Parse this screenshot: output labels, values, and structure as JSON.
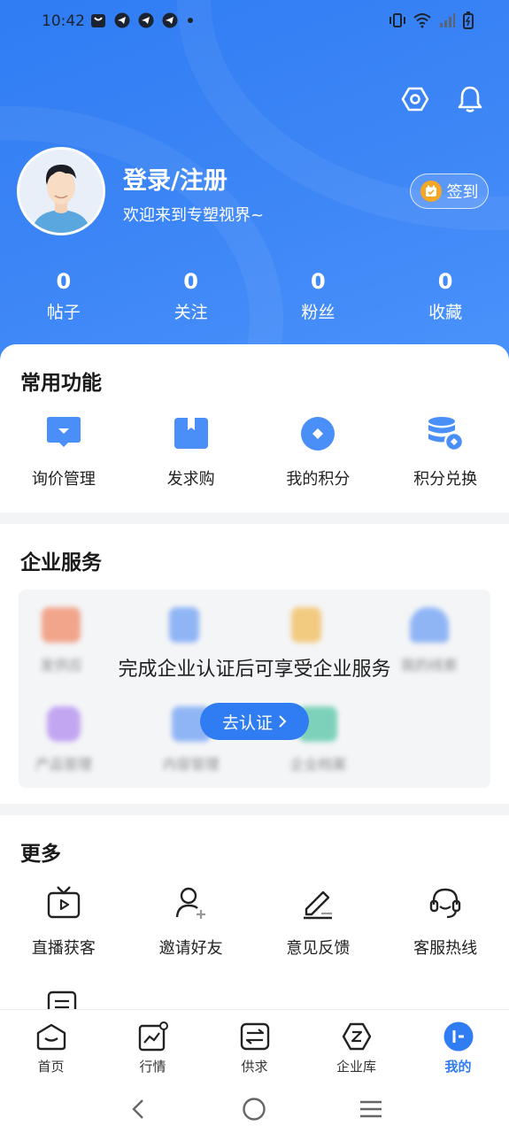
{
  "status_bar": {
    "time": "10:42"
  },
  "profile": {
    "title": "登录/注册",
    "welcome": "欢迎来到专塑视界~",
    "signin_label": "签到"
  },
  "stats": [
    {
      "value": "0",
      "label": "帖子"
    },
    {
      "value": "0",
      "label": "关注"
    },
    {
      "value": "0",
      "label": "粉丝"
    },
    {
      "value": "0",
      "label": "收藏"
    }
  ],
  "common": {
    "title": "常用功能",
    "items": [
      {
        "label": "询价管理",
        "icon": "inquiry-icon"
      },
      {
        "label": "发求购",
        "icon": "purchase-request-icon"
      },
      {
        "label": "我的积分",
        "icon": "points-icon"
      },
      {
        "label": "积分兑换",
        "icon": "points-exchange-icon"
      }
    ]
  },
  "enterprise": {
    "title": "企业服务",
    "row1": [
      "发供应",
      "",
      "",
      "我的线索"
    ],
    "row2": [
      "产品管理",
      "内容管理",
      "企业档案"
    ],
    "overlay_text": "完成企业认证后可享受企业服务",
    "verify_label": "去认证"
  },
  "more": {
    "title": "更多",
    "items": [
      {
        "label": "直播获客",
        "icon": "live-tv-icon"
      },
      {
        "label": "邀请好友",
        "icon": "invite-user-icon"
      },
      {
        "label": "意见反馈",
        "icon": "feedback-edit-icon"
      },
      {
        "label": "客服热线",
        "icon": "headset-icon"
      }
    ]
  },
  "tabbar": [
    {
      "label": "首页",
      "icon": "home-icon"
    },
    {
      "label": "行情",
      "icon": "market-chart-icon"
    },
    {
      "label": "供求",
      "icon": "exchange-icon"
    },
    {
      "label": "企业库",
      "icon": "enterprise-library-icon"
    },
    {
      "label": "我的",
      "icon": "profile-icon",
      "active": true
    }
  ],
  "colors": {
    "primary": "#2f7cf3",
    "accent": "#f5a623"
  }
}
